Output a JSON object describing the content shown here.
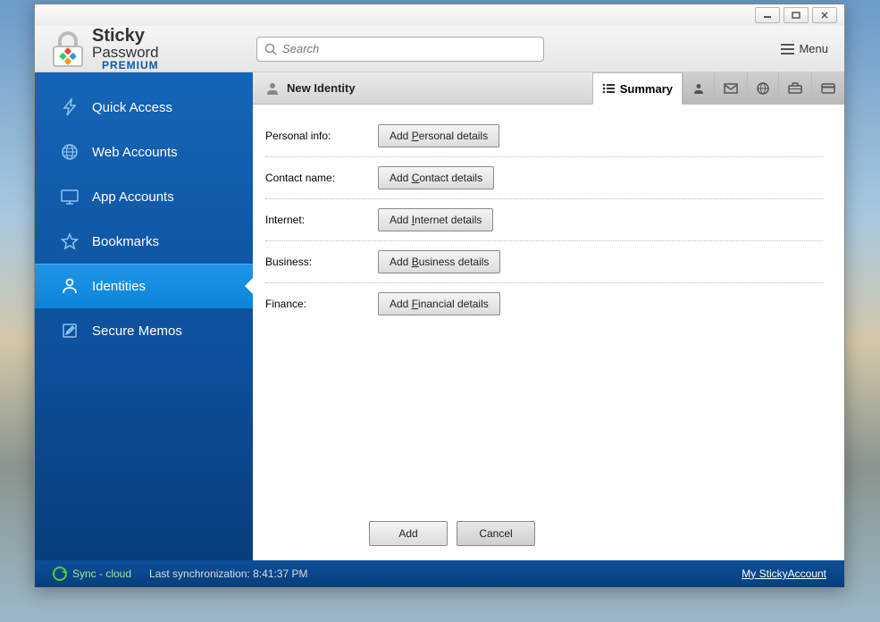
{
  "app": {
    "name1": "Sticky",
    "name2": "Password",
    "tier": "PREMIUM"
  },
  "search": {
    "placeholder": "Search"
  },
  "menu": {
    "label": "Menu"
  },
  "sidebar": {
    "items": [
      {
        "label": "Quick Access"
      },
      {
        "label": "Web Accounts"
      },
      {
        "label": "App Accounts"
      },
      {
        "label": "Bookmarks"
      },
      {
        "label": "Identities"
      },
      {
        "label": "Secure Memos"
      }
    ]
  },
  "header": {
    "title": "New Identity",
    "summary_tab": "Summary"
  },
  "form": {
    "rows": [
      {
        "label": "Personal info:",
        "button_prefix": "Add ",
        "button_u": "P",
        "button_suffix": "ersonal details"
      },
      {
        "label": "Contact name:",
        "button_prefix": "Add ",
        "button_u": "C",
        "button_suffix": "ontact details"
      },
      {
        "label": "Internet:",
        "button_prefix": "Add ",
        "button_u": "I",
        "button_suffix": "nternet details"
      },
      {
        "label": "Business:",
        "button_prefix": "Add ",
        "button_u": "B",
        "button_suffix": "usiness details"
      },
      {
        "label": "Finance:",
        "button_prefix": "Add ",
        "button_u": "F",
        "button_suffix": "inancial details"
      }
    ],
    "add": "Add",
    "cancel": "Cancel"
  },
  "status": {
    "sync": "Sync - cloud",
    "last_sync_label": "Last synchronization: ",
    "last_sync_time": "8:41:37 PM",
    "account": "My StickyAccount",
    "account_u": "M"
  }
}
